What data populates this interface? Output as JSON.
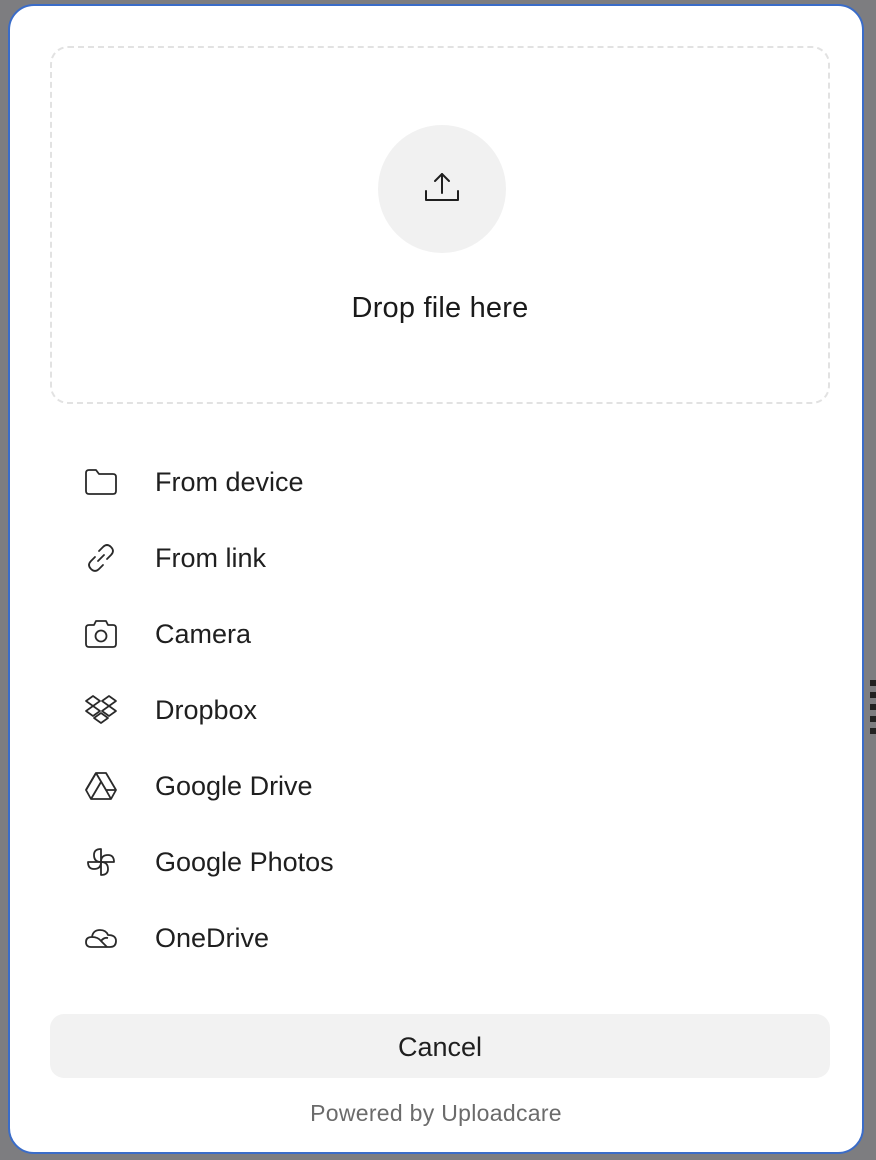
{
  "dropzone": {
    "title": "Drop file here",
    "icon": "upload-icon"
  },
  "sources": [
    {
      "label": "From device",
      "icon": "folder-icon"
    },
    {
      "label": "From link",
      "icon": "link-icon"
    },
    {
      "label": "Camera",
      "icon": "camera-icon"
    },
    {
      "label": "Dropbox",
      "icon": "dropbox-icon"
    },
    {
      "label": "Google Drive",
      "icon": "google-drive-icon"
    },
    {
      "label": "Google Photos",
      "icon": "google-photos-icon"
    },
    {
      "label": "OneDrive",
      "icon": "onedrive-icon"
    }
  ],
  "actions": {
    "cancel_label": "Cancel"
  },
  "footer": {
    "powered_by": "Powered by Uploadcare"
  },
  "colors": {
    "modal_border": "#3a6cc8",
    "circle_bg": "#f1f1f1",
    "button_bg": "#f2f2f2",
    "text": "#1f1f1f",
    "muted_text": "#6b6b6b"
  }
}
